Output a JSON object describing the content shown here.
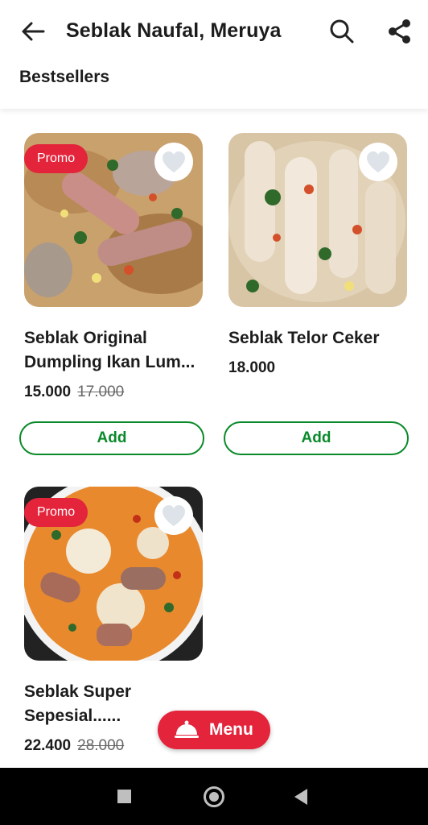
{
  "header": {
    "title": "Seblak Naufal, Meruya",
    "tab": "Bestsellers"
  },
  "products": [
    {
      "name": "Seblak Original\nDumpling Ikan Lum...",
      "price": "15.000",
      "old_price": "17.000",
      "promo": "Promo",
      "add_label": "Add"
    },
    {
      "name": "Seblak Telor Ceker",
      "price": "18.000",
      "old_price": "",
      "promo": "",
      "add_label": "Add"
    },
    {
      "name": "Seblak Super\nSepesial......",
      "price": "22.400",
      "old_price": "28.000",
      "promo": "Promo",
      "add_label": ""
    }
  ],
  "menu_button": {
    "label": "Menu"
  },
  "colors": {
    "accent_red": "#e3243b",
    "accent_green": "#0a8a2a"
  }
}
